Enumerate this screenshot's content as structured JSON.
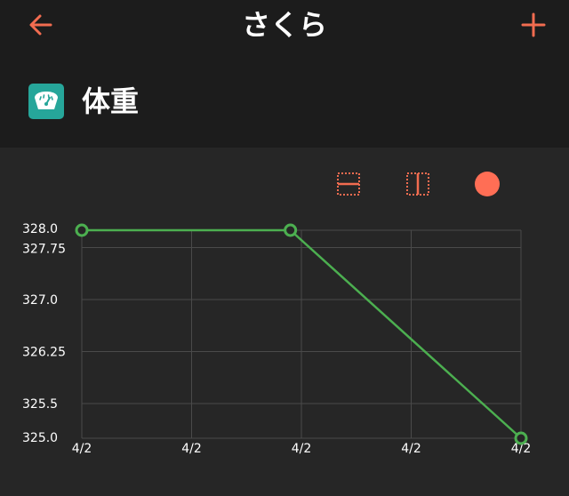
{
  "header": {
    "title": "さくら",
    "back_icon": "arrow-left-icon",
    "add_icon": "plus-icon",
    "accent_color": "#f26c50"
  },
  "metric": {
    "title": "体重",
    "icon": "scale-icon",
    "icon_color": "#26a69a"
  },
  "toolbar": {
    "items": [
      "horizontal-grid-toggle-icon",
      "vertical-grid-toggle-icon",
      "point-toggle-icon"
    ],
    "dot_color": "#ff6e55"
  },
  "chart_data": {
    "type": "line",
    "x_tick_labels": [
      "4/2",
      "4/2",
      "4/2",
      "4/2",
      "4/2"
    ],
    "y_ticks": [
      328.0,
      327.75,
      327.0,
      326.25,
      325.5,
      325.0
    ],
    "y_tick_labels": [
      "328.0",
      "327.75",
      "327.0",
      "326.25",
      "325.5",
      "325.0"
    ],
    "ylim": [
      325.0,
      328.0
    ],
    "xlim": [
      0,
      4
    ],
    "series": [
      {
        "points": [
          {
            "x": 0,
            "y": 328.0
          },
          {
            "x": 1.9,
            "y": 328.0
          },
          {
            "x": 4,
            "y": 325.0
          }
        ],
        "color": "#4caf50"
      }
    ],
    "grid": true
  }
}
